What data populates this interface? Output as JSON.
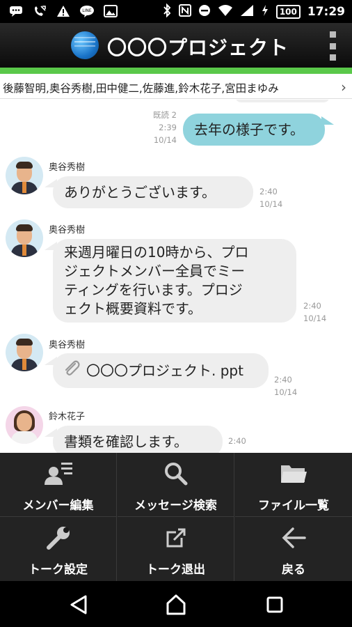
{
  "status_bar": {
    "battery": "100",
    "time": "17:29"
  },
  "header": {
    "title": "〇〇〇プロジェクト"
  },
  "members": {
    "text": "後藤智明,奥谷秀樹,田中健二,佐藤進,鈴木花子,宮田まゆみ"
  },
  "messages": [
    {
      "side": "right",
      "text": "去年の様子です。",
      "read": "既読 2",
      "time": "2:39",
      "date": "10/14"
    },
    {
      "side": "left",
      "sender": "奥谷秀樹",
      "text": "ありがとうございます。",
      "time": "2:40",
      "date": "10/14"
    },
    {
      "side": "left",
      "sender": "奥谷秀樹",
      "lines": [
        "来週月曜日の10時から、プロ",
        "ジェクトメンバー全員でミー",
        "ティングを行います。プロジ",
        "ェクト概要資料です。"
      ],
      "time": "2:40",
      "date": "10/14"
    },
    {
      "side": "left",
      "sender": "奥谷秀樹",
      "attachment": "〇〇〇プロジェクト. ppt",
      "time": "2:40",
      "date": "10/14"
    },
    {
      "side": "left",
      "sender": "鈴木花子",
      "text": "書類を確認します。",
      "time": "2:40"
    }
  ],
  "menu": {
    "items": [
      {
        "label": "メンバー編集",
        "icon": "member-edit-icon"
      },
      {
        "label": "メッセージ検索",
        "icon": "search-icon"
      },
      {
        "label": "ファイル一覧",
        "icon": "folder-icon"
      },
      {
        "label": "トーク設定",
        "icon": "wrench-icon"
      },
      {
        "label": "トーク退出",
        "icon": "exit-icon"
      },
      {
        "label": "戻る",
        "icon": "back-arrow-icon"
      }
    ]
  },
  "colors": {
    "accent_green": "#5ac84a",
    "my_bubble": "#8fd3dd",
    "other_bubble": "#eeeeee"
  }
}
